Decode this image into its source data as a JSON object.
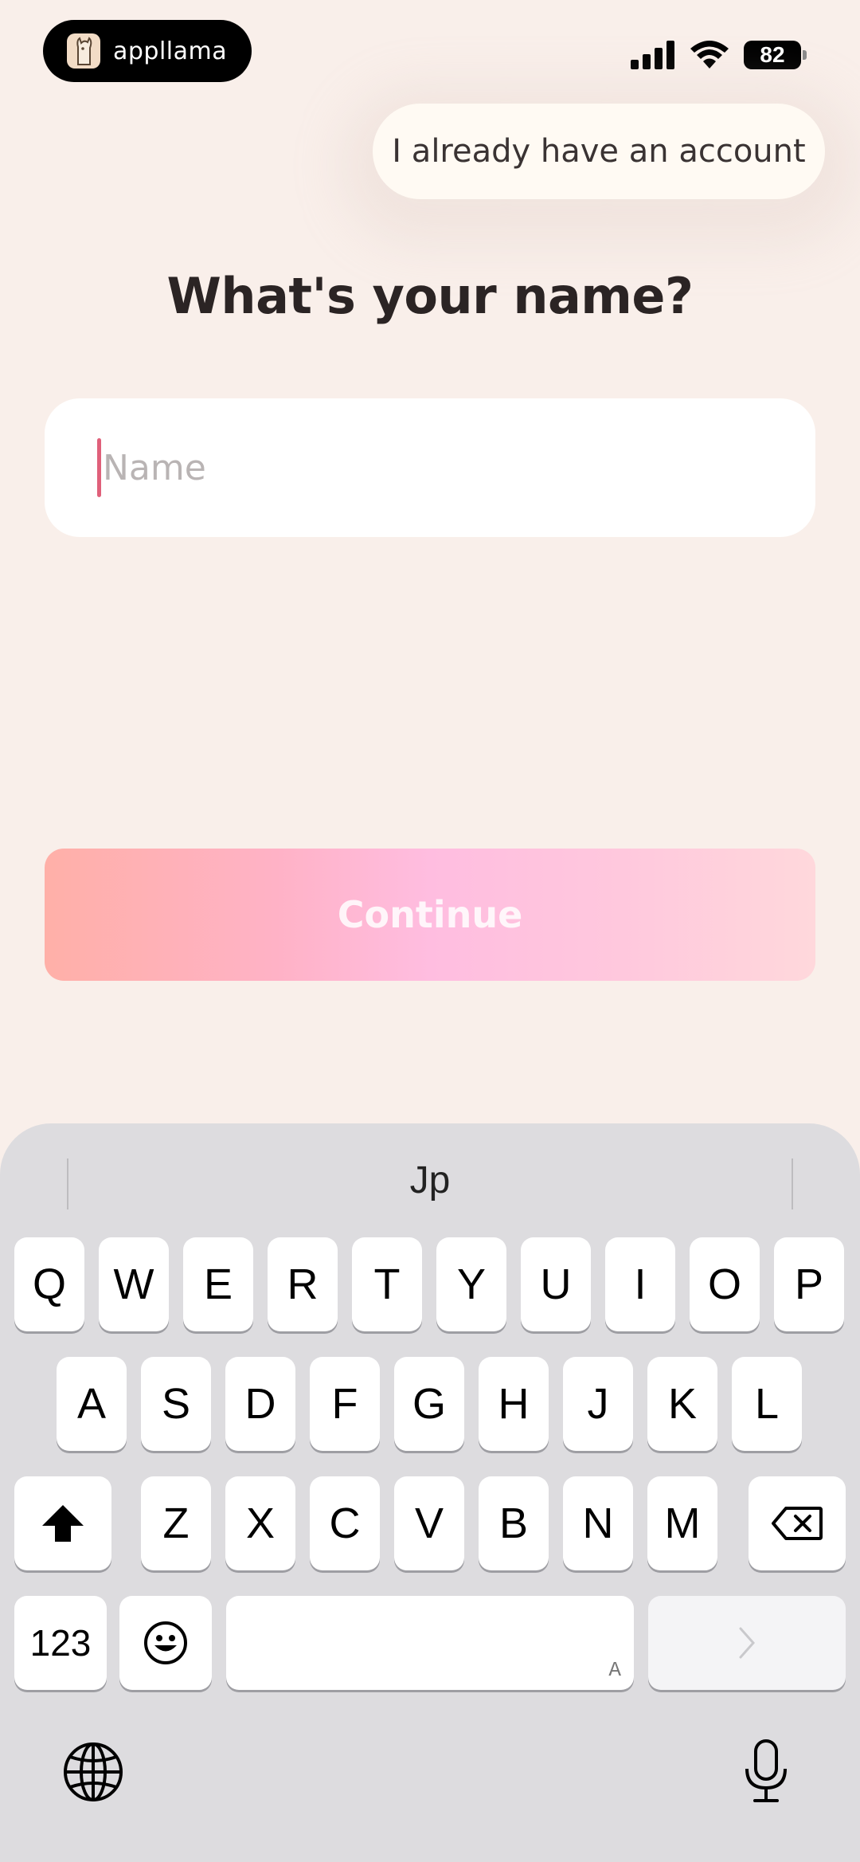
{
  "status_bar": {
    "app_name": "appllama",
    "battery": "82"
  },
  "header": {
    "account_button": "I already have an account"
  },
  "main": {
    "title": "What's your name?",
    "name_input": {
      "placeholder": "Name",
      "value": ""
    },
    "continue_label": "Continue"
  },
  "keyboard": {
    "suggestion": "Jp",
    "row1": [
      "Q",
      "W",
      "E",
      "R",
      "T",
      "Y",
      "U",
      "I",
      "O",
      "P"
    ],
    "row2": [
      "A",
      "S",
      "D",
      "F",
      "G",
      "H",
      "J",
      "K",
      "L"
    ],
    "row3": [
      "Z",
      "X",
      "C",
      "V",
      "B",
      "N",
      "M"
    ],
    "numbers_label": "123",
    "space_hint": "A"
  }
}
